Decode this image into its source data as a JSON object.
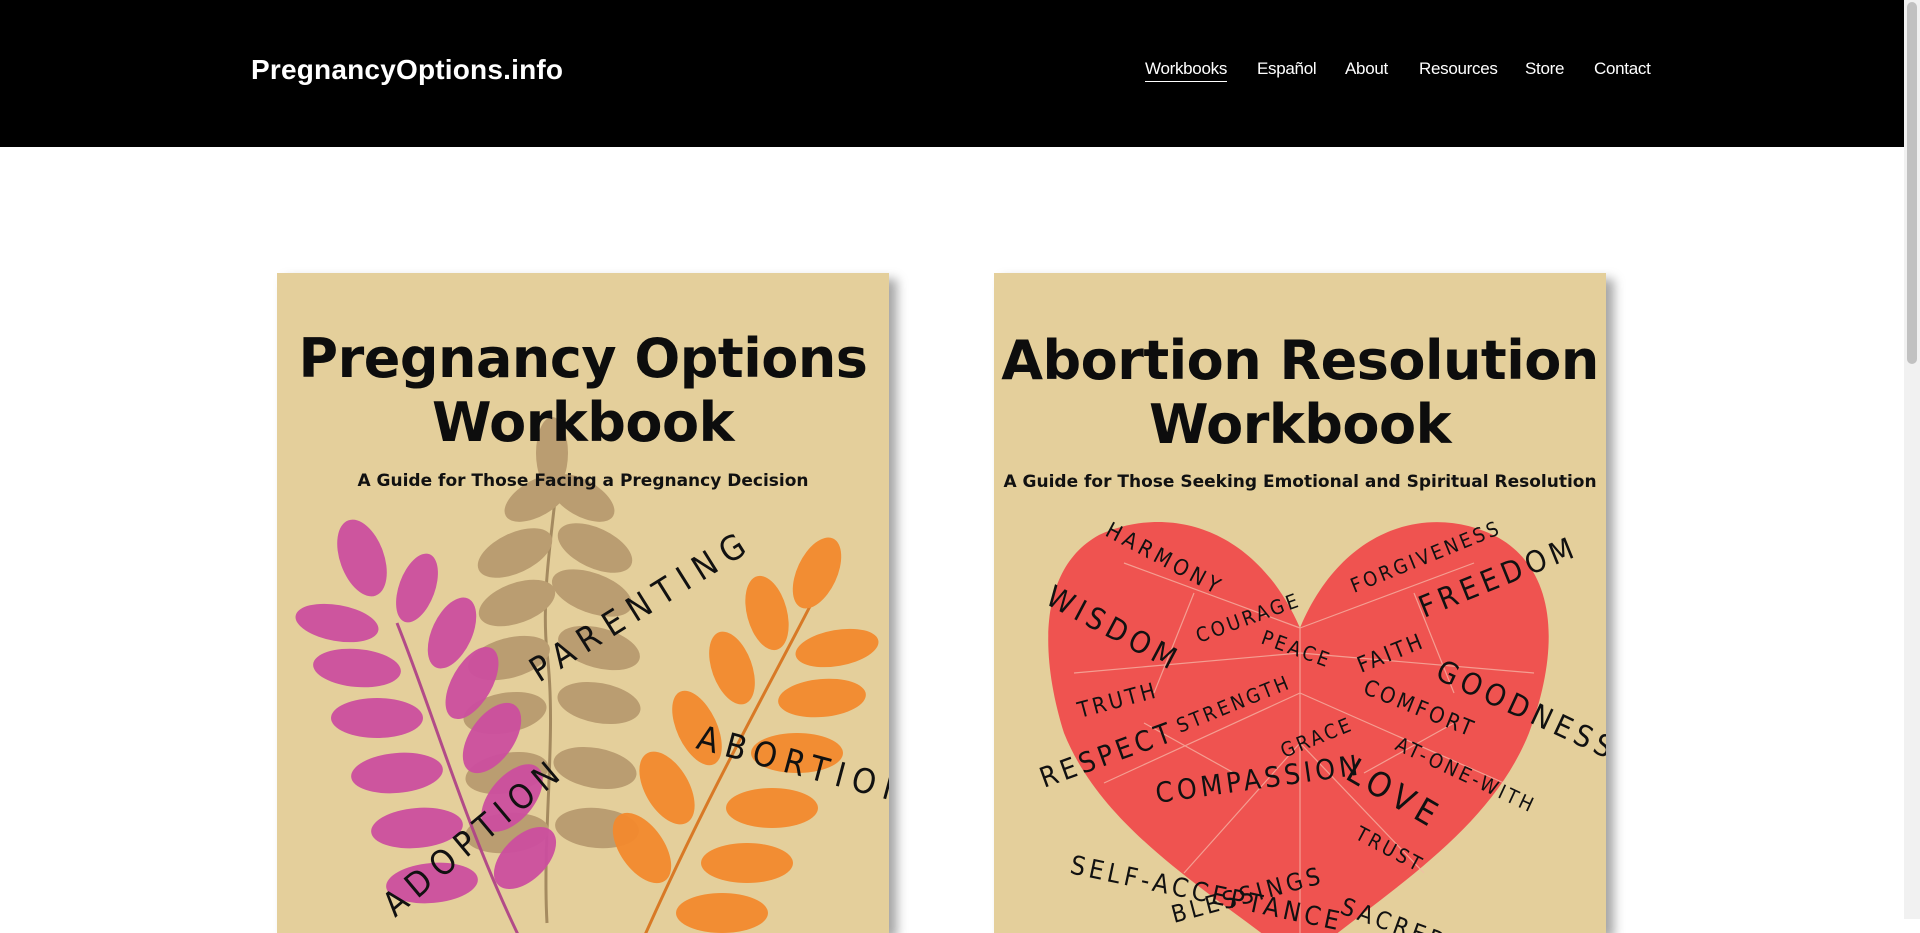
{
  "site": {
    "title": "PregnancyOptions.info"
  },
  "nav": {
    "items": [
      {
        "label": "Workbooks",
        "active": true
      },
      {
        "label": "Español",
        "active": false
      },
      {
        "label": "About",
        "active": false
      },
      {
        "label": "Resources",
        "active": false
      },
      {
        "label": "Store",
        "active": false
      },
      {
        "label": "Contact",
        "active": false
      }
    ]
  },
  "books": [
    {
      "title_line1": "Pregnancy Options",
      "title_line2": "Workbook",
      "subtitle": "A Guide for Those Facing a Pregnancy Decision",
      "cover_words": [
        "PARENTING",
        "ABORTION",
        "ADOPTION"
      ],
      "colors": {
        "cover": "#e4cf9b",
        "leaf_pink": "#cc4f9f",
        "leaf_tan": "#b3956a",
        "leaf_orange": "#f38a2e"
      }
    },
    {
      "title_line1": "Abortion Resolution",
      "title_line2": "Workbook",
      "subtitle": "A Guide for Those Seeking Emotional and Spiritual Resolution",
      "cover_words": [
        "HARMONY",
        "FORGIVENESS",
        "WISDOM",
        "COURAGE",
        "FREEDOM",
        "PEACE",
        "FAITH",
        "GOODNESS",
        "TRUTH",
        "STRENGTH",
        "COMFORT",
        "RESPECT",
        "GRACE",
        "AT-ONE-WITH",
        "COMPASSION",
        "LOVE",
        "SELF-ACCEPTANCE",
        "TRUST",
        "BLESSINGS",
        "SACRED"
      ],
      "colors": {
        "cover": "#e4cf9b",
        "heart": "#ef5350"
      }
    }
  ]
}
